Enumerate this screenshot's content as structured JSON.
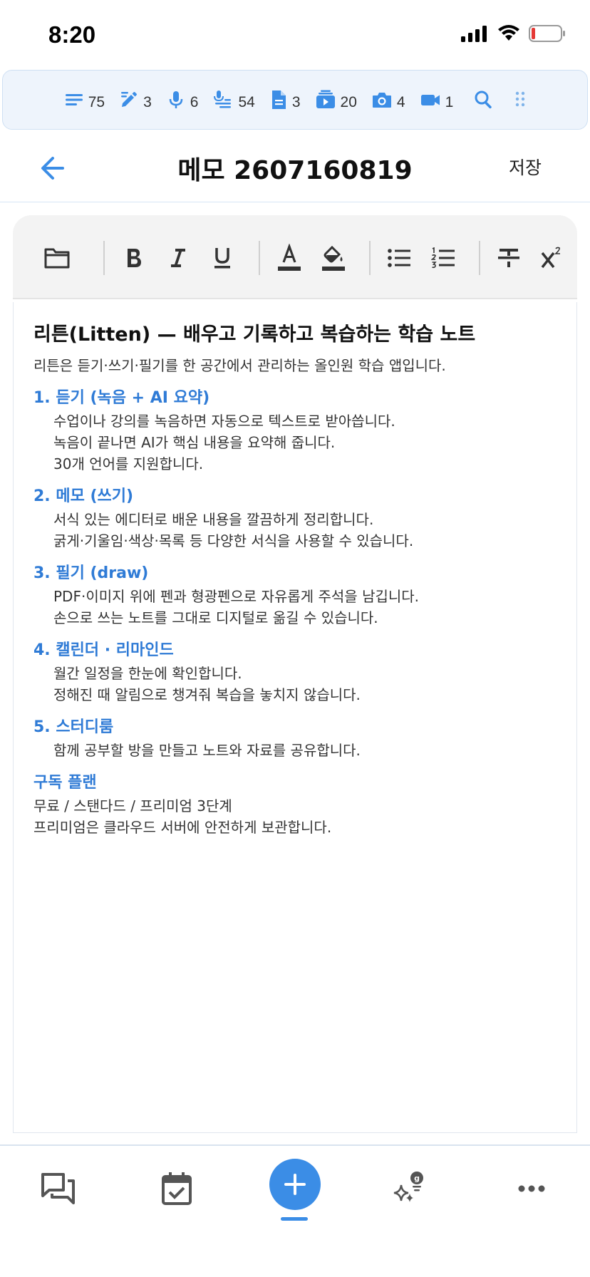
{
  "status_bar": {
    "time": "8:20"
  },
  "counters": [
    {
      "icon": "text-lines-icon",
      "count": "75"
    },
    {
      "icon": "edit-pen-icon",
      "count": "3"
    },
    {
      "icon": "microphone-icon",
      "count": "6"
    },
    {
      "icon": "voice-transcript-icon",
      "count": "54"
    },
    {
      "icon": "document-icon",
      "count": "3"
    },
    {
      "icon": "video-library-icon",
      "count": "20"
    },
    {
      "icon": "camera-icon",
      "count": "4"
    },
    {
      "icon": "video-camera-icon",
      "count": "1"
    }
  ],
  "header": {
    "title": "메모 2607160819",
    "save_label": "저장"
  },
  "toolbar": {
    "items": [
      "folder-icon",
      "bold-icon",
      "italic-icon",
      "underline-icon",
      "text-color-icon",
      "highlight-color-icon",
      "bulleted-list-icon",
      "numbered-list-icon",
      "strikethrough-icon",
      "superscript-icon"
    ]
  },
  "document": {
    "title": "리튼(Litten) — 배우고 기록하고 복습하는 학습 노트",
    "intro": "리튼은 듣기·쓰기·필기를 한 공간에서 관리하는 올인원 학습 앱입니다.",
    "sections": [
      {
        "heading": "1. 듣기 (녹음 + AI 요약)",
        "lines": [
          "수업이나 강의를 녹음하면 자동으로 텍스트로 받아씁니다.",
          "녹음이 끝나면 AI가 핵심 내용을 요약해 줍니다.",
          "30개 언어를 지원합니다."
        ]
      },
      {
        "heading": "2. 메모 (쓰기)",
        "lines": [
          "서식 있는 에디터로 배운 내용을 깔끔하게 정리합니다.",
          "굵게·기울임·색상·목록 등 다양한 서식을 사용할 수 있습니다."
        ]
      },
      {
        "heading": "3. 필기 (draw)",
        "lines": [
          "PDF·이미지 위에 펜과 형광펜으로 자유롭게 주석을 남깁니다.",
          "손으로 쓰는 노트를 그대로 디지털로 옮길 수 있습니다."
        ]
      },
      {
        "heading": "4. 캘린더 · 리마인드",
        "lines": [
          "월간 일정을 한눈에 확인합니다.",
          "정해진 때 알림으로 챙겨줘 복습을 놓치지 않습니다."
        ]
      },
      {
        "heading": "5. 스터디룸",
        "lines": [
          "함께 공부할 방을 만들고 노트와 자료를 공유합니다."
        ]
      }
    ],
    "plan": {
      "heading": "구독 플랜",
      "lines": [
        "무료 / 스탠다드 / 프리미엄 3단계",
        "프리미엄은 클라우드 서버에 안전하게 보관합니다."
      ]
    }
  },
  "bottom_nav": {
    "items": [
      "chat-icon",
      "calendar-check-icon",
      "add-icon",
      "ai-sparkle-icon",
      "more-icon"
    ]
  },
  "colors": {
    "accent": "#3b8de6",
    "heading_blue": "#2f7bd6",
    "strip_bg": "#eef4fc"
  }
}
